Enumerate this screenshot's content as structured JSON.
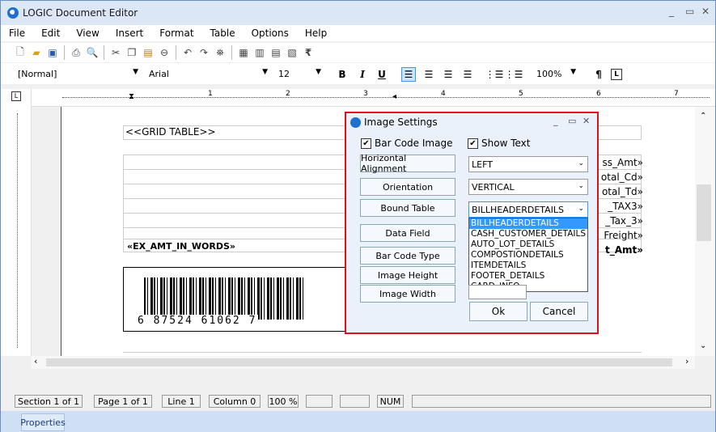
{
  "window": {
    "title": "LOGIC Document Editor"
  },
  "menu": [
    "File",
    "Edit",
    "View",
    "Insert",
    "Format",
    "Table",
    "Options",
    "Help"
  ],
  "toolbar": {
    "style": "[Normal]",
    "font": "Arial",
    "size": "12",
    "zoom": "100%",
    "bold": "B",
    "italic": "I",
    "underline": "U",
    "rupee": "₹",
    "para": "¶"
  },
  "ruler_marks": [
    "1",
    "2",
    "3",
    "4",
    "5",
    "6",
    "7"
  ],
  "document": {
    "grid_placeholder": "<<GRID TABLE>>",
    "amount_words": "«EX_AMT_IN_WORDS»",
    "right_fields": [
      "ss_Amt»",
      "otal_Cd»",
      "otal_Td»",
      "_TAX3»",
      "_Tax_3»",
      "Freight»",
      "t_Amt»"
    ],
    "barcode_digits": "6 87524 61062 7"
  },
  "dialog": {
    "title": "Image Settings",
    "bar_code_image": "Bar Code Image",
    "show_text": "Show Text",
    "buttons": [
      "Horizontal Alignment",
      "Orientation",
      "Bound Table",
      "Data Field",
      "Bar Code Type",
      "Image Height",
      "Image Width"
    ],
    "horizontal_alignment": "LEFT",
    "orientation": "VERTICAL",
    "bound_table": "BILLHEADERDETAILS",
    "bound_table_options": [
      "BILLHEADERDETAILS",
      "CASH_CUSTOMER_DETAILS",
      "AUTO_LOT_DETAILS",
      "COMPOSTIONDETAILS",
      "ITEMDETAILS",
      "FOOTER_DETAILS",
      "CARD_INFO"
    ],
    "ok": "Ok",
    "cancel": "Cancel"
  },
  "status": [
    "Section 1 of 1",
    "Page 1 of 1",
    "Line 1",
    "Column 0",
    "100 %",
    "",
    "",
    "NUM",
    ""
  ],
  "properties_tab": "Properties",
  "colors": {
    "highlight": "#3399ff",
    "dialog_border": "#e0101a",
    "title_bg": "#dbe7f5"
  }
}
